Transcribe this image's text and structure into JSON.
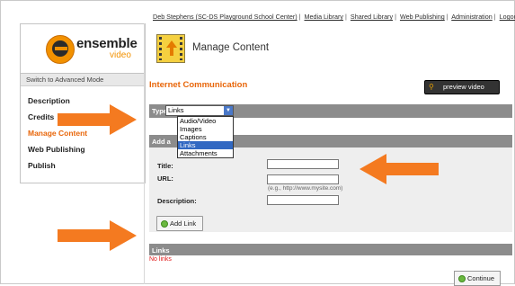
{
  "topnav": {
    "user": "Deb Stephens (SC-DS Playground School Center)",
    "links": [
      "Media Library",
      "Shared Library",
      "Web Publishing",
      "Administration",
      "Logout"
    ]
  },
  "sidebar": {
    "logo_text": "ensemble",
    "logo_sub": "video",
    "switch_mode": "Switch to Advanced Mode",
    "items": [
      {
        "label": "Description",
        "active": false
      },
      {
        "label": "Credits",
        "active": false
      },
      {
        "label": "Manage Content",
        "active": true
      },
      {
        "label": "Web Publishing",
        "active": false
      },
      {
        "label": "Publish",
        "active": false
      }
    ]
  },
  "header": {
    "title": "Manage Content"
  },
  "content": {
    "section_title": "Internet Communication",
    "preview_label": "preview video",
    "type_label": "Type:",
    "type_value": "Links",
    "type_options": [
      "Audio/Video",
      "Images",
      "Captions",
      "Links",
      "Attachments"
    ],
    "type_selected_index": 3,
    "add_bar_label": "Add a",
    "form": {
      "title_label": "Title:",
      "url_label": "URL:",
      "url_hint": "(e.g., http://www.mysite.com)",
      "description_label": "Description:"
    },
    "add_link_label": "Add Link",
    "links_bar_label": "Links",
    "no_links": "No links",
    "continue_label": "Continue"
  },
  "colors": {
    "accent": "#e8660a",
    "annotation_arrow": "#f47a20",
    "bar_gray": "#8c8c8c",
    "selected": "#3168c2"
  }
}
